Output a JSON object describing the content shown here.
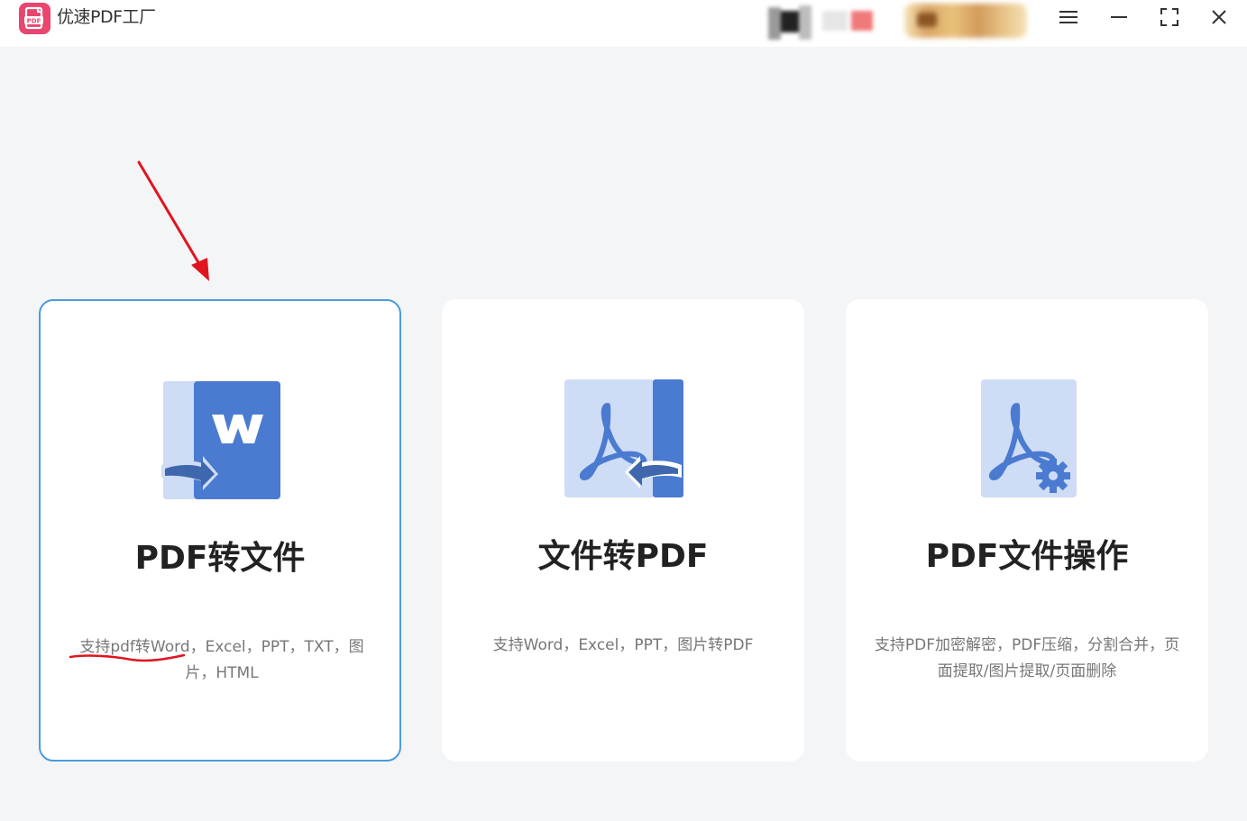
{
  "app": {
    "title": "优速PDF工厂",
    "brand_color": "#e8456f"
  },
  "window_controls": {
    "menu_icon": "hamburger-menu-icon",
    "minimize_icon": "minimize-icon",
    "maximize_icon": "fullscreen-icon",
    "close_icon": "close-icon"
  },
  "cards": [
    {
      "title": "PDF转文件",
      "description": "支持pdf转Word，Excel，PPT，TXT，图片，HTML",
      "icon": "pdf-to-word-icon",
      "selected": true
    },
    {
      "title": "文件转PDF",
      "description": "支持Word，Excel，PPT，图片转PDF",
      "icon": "file-to-pdf-icon",
      "selected": false
    },
    {
      "title": "PDF文件操作",
      "description": "支持PDF加密解密，PDF压缩，分割合并，页面提取/图片提取/页面删除",
      "icon": "pdf-settings-icon",
      "selected": false
    }
  ],
  "colors": {
    "accent_blue": "#4a7bd0",
    "light_blue": "#cfdcf5",
    "selected_border": "#4a9be0",
    "annotation_red": "#e0141e"
  }
}
